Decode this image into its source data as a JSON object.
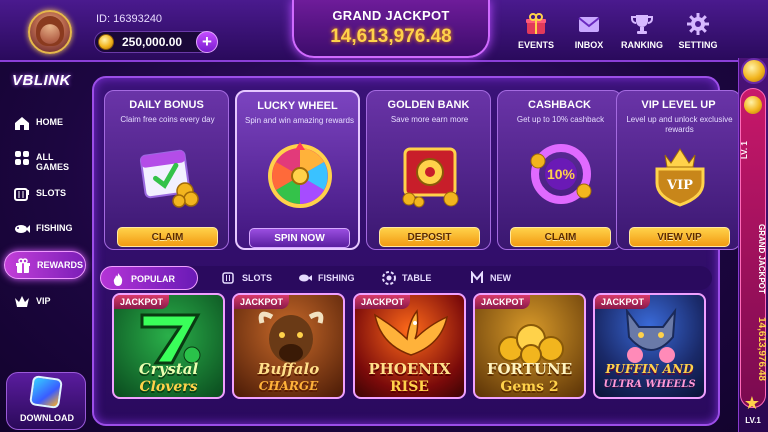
{
  "player": {
    "id_label": "ID: 16393240",
    "coins": "250,000.00",
    "add_label": "+"
  },
  "jackpot": {
    "title": "GRAND JACKPOT",
    "value": "14,613,976.48"
  },
  "topnav": {
    "events": "EVENTS",
    "inbox": "INBOX",
    "ranking": "RANKING",
    "setting": "SETTING"
  },
  "logo": "VBLINK",
  "sidebar": {
    "items": [
      {
        "label": "HOME",
        "icon": "home-icon"
      },
      {
        "label": "ALL GAMES",
        "icon": "grid-icon"
      },
      {
        "label": "SLOTS",
        "icon": "slots-icon"
      },
      {
        "label": "FISHING",
        "icon": "fish-icon"
      },
      {
        "label": "REWARDS",
        "icon": "gift-icon"
      },
      {
        "label": "VIP",
        "icon": "crown-icon"
      }
    ],
    "active": "REWARDS",
    "download": "DOWNLOAD"
  },
  "promos": [
    {
      "title": "DAILY BONUS",
      "desc": "Claim free coins every day",
      "button": "CLAIM",
      "icon": "calendar-icon"
    },
    {
      "title": "LUCKY WHEEL",
      "desc": "Spin and win amazing rewards",
      "button": "SPIN NOW",
      "icon": "wheel-icon"
    },
    {
      "title": "GOLDEN BANK",
      "desc": "Save more earn more",
      "button": "DEPOSIT",
      "icon": "safe-icon"
    },
    {
      "title": "CASHBACK",
      "desc": "Get up to 10% cashback",
      "button": "CLAIM",
      "icon": "cashback-icon",
      "badge": "10%"
    },
    {
      "title": "VIP LEVEL UP",
      "desc": "Level up and unlock exclusive rewards",
      "button": "VIEW VIP",
      "icon": "vip-shield-icon",
      "badge": "VIP"
    }
  ],
  "tabs": [
    {
      "label": "POPULAR",
      "icon": "flame-icon",
      "active": true
    },
    {
      "label": "SLOTS",
      "icon": "slots-icon"
    },
    {
      "label": "FISHING",
      "icon": "fish-icon"
    },
    {
      "label": "TABLE",
      "icon": "chip-icon"
    },
    {
      "label": "NEW",
      "icon": "new-icon"
    }
  ],
  "games": [
    {
      "badge": "JACKPOT",
      "line1": "Crystal",
      "line2": "Clovers",
      "bg": "#0f6a2a",
      "accent": "#4cff6a"
    },
    {
      "badge": "JACKPOT",
      "line1": "Buffalo",
      "line2": "CHARGE",
      "bg": "#6a2a0a",
      "accent": "#ffb23a"
    },
    {
      "badge": "JACKPOT",
      "line1": "PHOENIX",
      "line2": "RISE",
      "bg": "#7a0a0a",
      "accent": "#ffd24a"
    },
    {
      "badge": "JACKPOT",
      "line1": "FORTUNE",
      "line2": "Gems 2",
      "bg": "#5a3a06",
      "accent": "#ffd24a"
    },
    {
      "badge": "JACKPOT",
      "line1": "PUFFIN AND",
      "line2": "ULTRA WHEELS",
      "bg": "#1a3a7a",
      "accent": "#ff7ad8"
    }
  ],
  "rail": {
    "level_top": "LV. 1",
    "jackpot_title": "GRAND JACKPOT",
    "jackpot_value": "14,613,976.48",
    "level_bottom": "LV.1"
  }
}
